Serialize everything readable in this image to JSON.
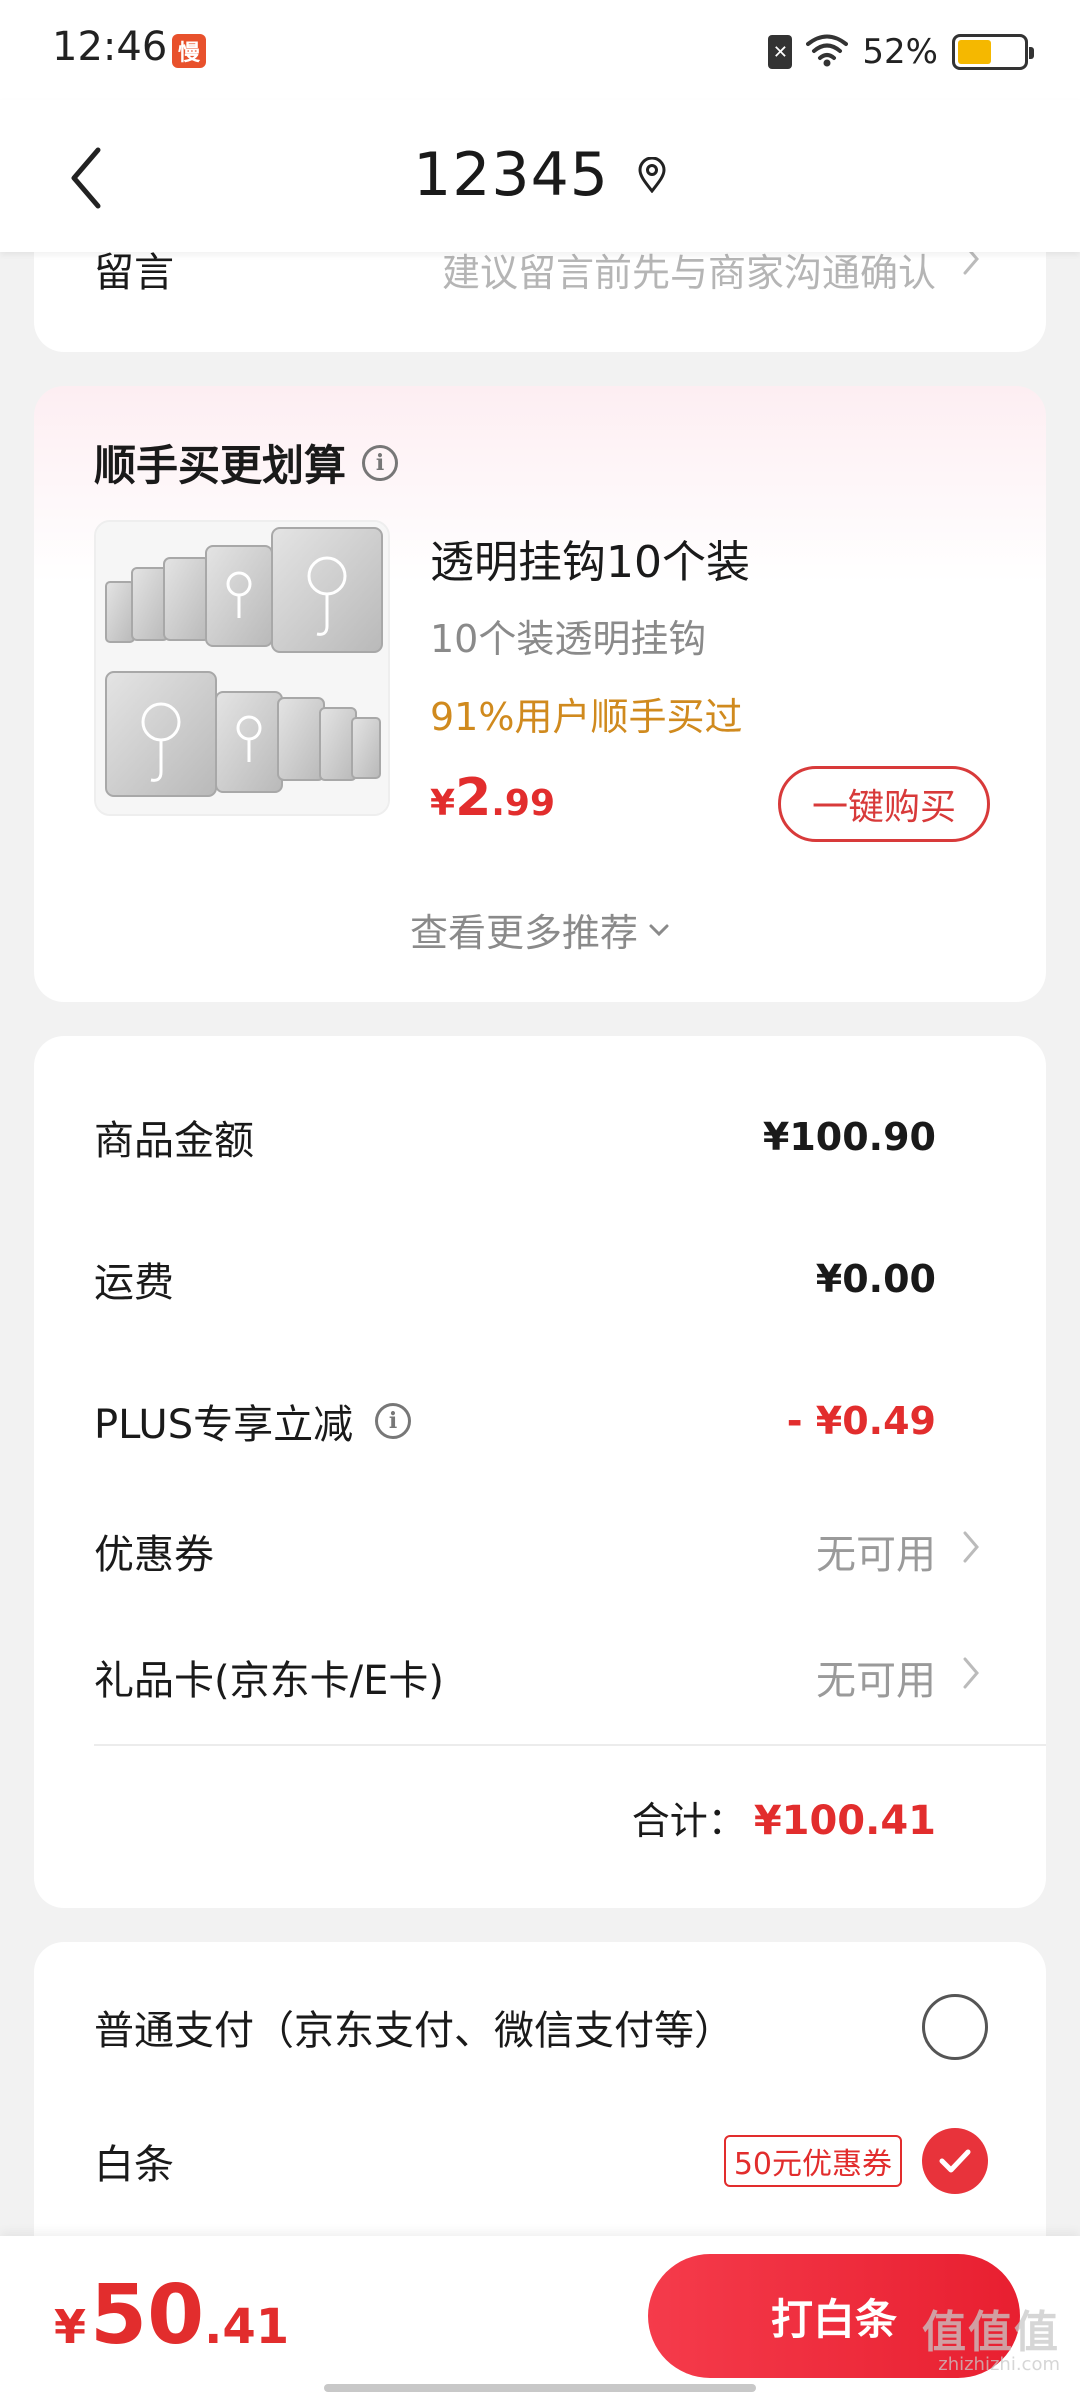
{
  "status_bar": {
    "time": "12:46",
    "app_icon_glyph": "慢",
    "sim_glyph": "✕",
    "battery_percent": "52%",
    "battery_level": 0.52
  },
  "header": {
    "title": "12345",
    "back_icon": "chevron-left-icon",
    "location_icon": "location-pin-icon"
  },
  "remark": {
    "label": "留言",
    "placeholder": "建议留言前先与商家沟通确认"
  },
  "recommend": {
    "title": "顺手买更划算",
    "product": {
      "name": "透明挂钩10个装",
      "subtitle": "10个装透明挂钩",
      "hint": "91%用户顺手买过",
      "price_symbol": "¥",
      "price_int": "2",
      "price_dec": ".99"
    },
    "buy_label": "一键购买",
    "more_label": "查看更多推荐"
  },
  "summary": {
    "rows": [
      {
        "label": "商品金额",
        "value": "¥100.90"
      },
      {
        "label": "运费",
        "value": "¥0.00"
      },
      {
        "label": "PLUS专享立减",
        "value": "- ¥0.49"
      },
      {
        "label": "优惠券",
        "value": "无可用"
      },
      {
        "label": "礼品卡(京东卡/E卡)",
        "value": "无可用"
      }
    ],
    "total_label": "合计：",
    "total_value": "¥100.41"
  },
  "payment": {
    "options": [
      {
        "label": "普通支付（京东支付、微信支付等）",
        "selected": false
      },
      {
        "label": "白条",
        "tag": "50元优惠券",
        "selected": true
      }
    ]
  },
  "bottom_bar": {
    "price_symbol": "¥",
    "price_int": "50",
    "price_dec": ".41",
    "pay_label": "打白条",
    "watermark": "值值值",
    "watermark_sub": "zhizhizhi.com"
  },
  "colors": {
    "accent_red": "#e22d2d",
    "hint_orange": "#d08a1e",
    "muted_gray": "#9a9a9a"
  }
}
